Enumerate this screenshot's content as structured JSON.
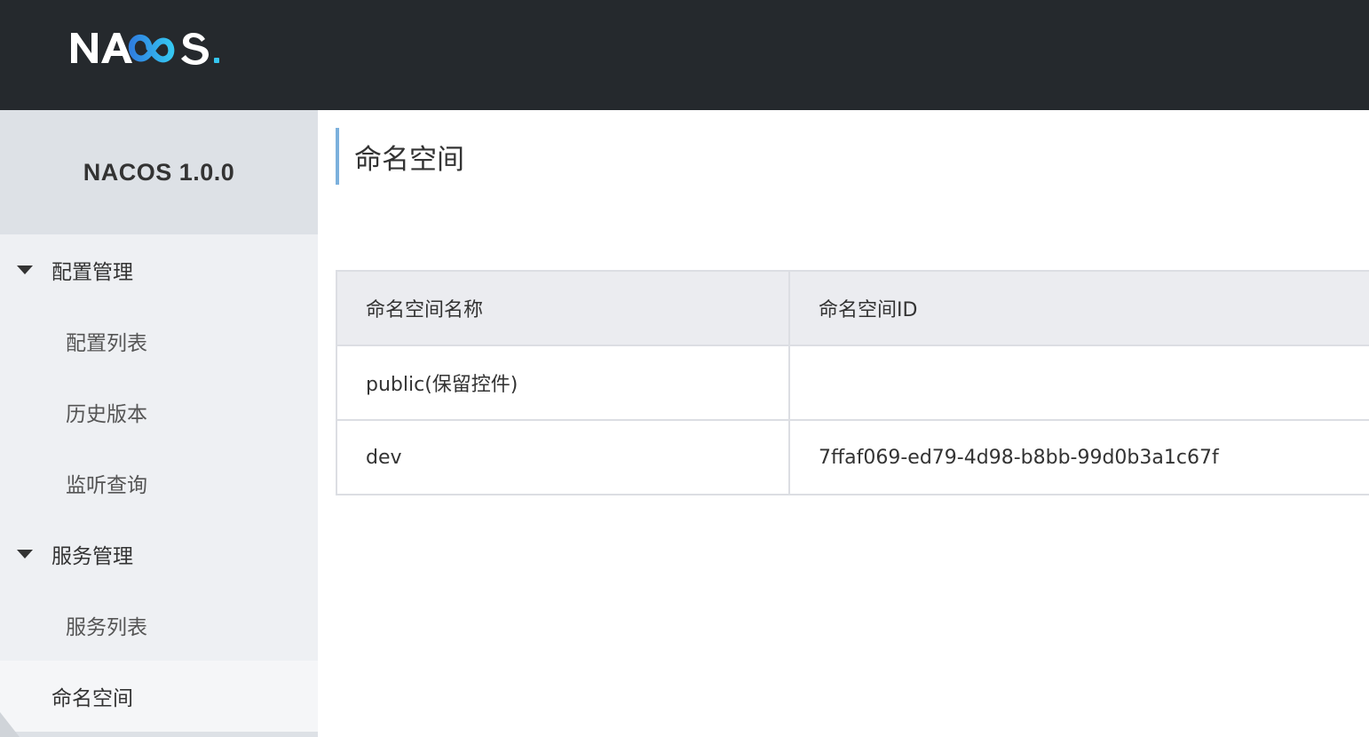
{
  "header": {
    "logo_text": "NACOS.",
    "logo_colors": {
      "white": "#ffffff",
      "accent_start": "#2f7fe0",
      "accent_end": "#35c6f1"
    }
  },
  "sidebar": {
    "title": "NACOS 1.0.0",
    "groups": [
      {
        "label": "配置管理",
        "icon": "caret-down-icon",
        "items": [
          {
            "label": "配置列表"
          },
          {
            "label": "历史版本"
          },
          {
            "label": "监听查询"
          }
        ]
      },
      {
        "label": "服务管理",
        "icon": "caret-down-icon",
        "items": [
          {
            "label": "服务列表"
          }
        ]
      }
    ],
    "active_item": {
      "label": "命名空间"
    }
  },
  "main": {
    "title": "命名空间",
    "table": {
      "columns": [
        "命名空间名称",
        "命名空间ID"
      ],
      "rows": [
        {
          "name": "public(保留控件)",
          "id": ""
        },
        {
          "name": "dev",
          "id": "7ffaf069-ed79-4d98-b8bb-99d0b3a1c67f"
        }
      ]
    }
  },
  "colors": {
    "header_bg": "#25292d",
    "sidebar_bg": "#eef0f3",
    "sidebar_title_bg": "#dde1e6",
    "title_accent": "#7cb1dd",
    "table_header_bg": "#ebecf0"
  }
}
